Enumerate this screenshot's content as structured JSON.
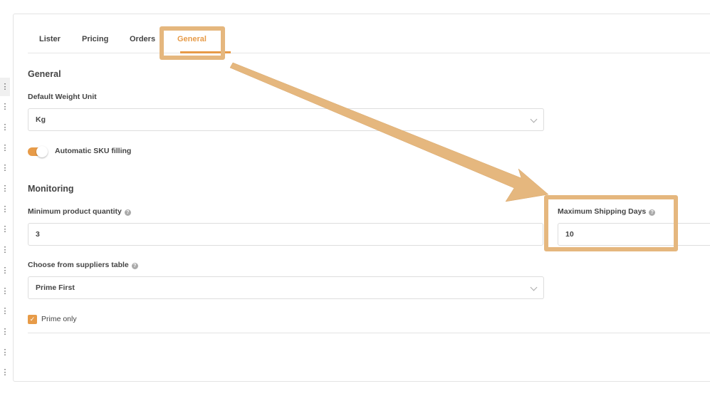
{
  "tabs": [
    {
      "label": "Lister"
    },
    {
      "label": "Pricing"
    },
    {
      "label": "Orders"
    },
    {
      "label": "General",
      "active": true
    }
  ],
  "general": {
    "title": "General",
    "weight_label": "Default Weight Unit",
    "weight_value": "Kg",
    "sku_label": "Automatic SKU filling",
    "sku_on": true
  },
  "monitoring": {
    "title": "Monitoring",
    "min_qty_label": "Minimum product quantity",
    "min_qty_value": "3",
    "max_ship_label": "Maximum Shipping Days",
    "max_ship_value": "10",
    "suppliers_label": "Choose from suppliers table",
    "suppliers_value": "Prime First",
    "prime_only_label": "Prime only",
    "prime_only_checked": true
  },
  "help_glyph": "?",
  "colors": {
    "accent": "#e79b48",
    "annotation": "#e5b77e"
  }
}
